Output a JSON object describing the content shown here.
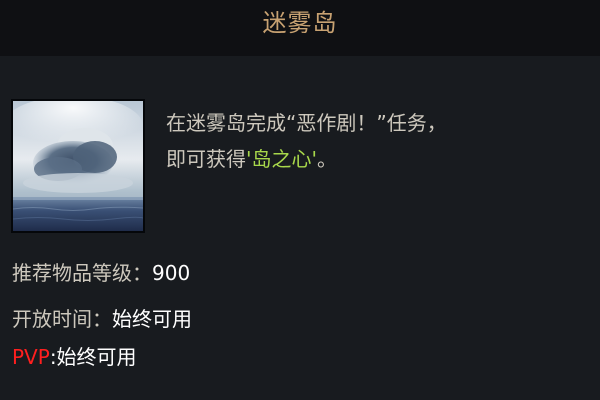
{
  "header": {
    "title": "迷雾岛"
  },
  "content": {
    "thumbnail_icon": "island-cloud-icon",
    "description": {
      "line1": "在迷雾岛完成“恶作剧！”任务，",
      "line2_prefix": "即可获得",
      "highlight": "'岛之心'",
      "line2_suffix": "。"
    },
    "stats": [
      {
        "label": "推荐物品等级：",
        "value": "900"
      },
      {
        "label": "开放时间：",
        "value": "始终可用"
      },
      {
        "label": "PVP",
        "value": ":始终可用"
      }
    ]
  },
  "colors": {
    "title": "#c8a272",
    "highlight": "#a8d84b",
    "pvp": "#ff1f1f",
    "label": "#cdc8bd",
    "value": "#ffffff"
  }
}
